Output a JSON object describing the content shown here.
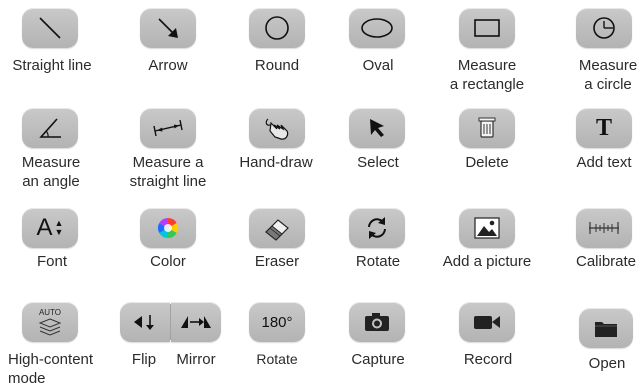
{
  "buttons": {
    "straight_line": "Straight line",
    "arrow": "Arrow",
    "round": "Round",
    "oval": "Oval",
    "measure_rectangle": "Measure\na rectangle",
    "measure_circle": "Measure\na circle",
    "measure_angle": "Measure\nan angle",
    "measure_straight_line": "Measure a\nstraight line",
    "hand_draw": "Hand-draw",
    "select": "Select",
    "delete": "Delete",
    "add_text": "Add text",
    "font": "Font",
    "color": "Color",
    "eraser": "Eraser",
    "rotate": "Rotate",
    "add_picture": "Add a picture",
    "calibrate": "Calibrate",
    "high_content_mode": "High-content\nmode",
    "flip": "Flip",
    "mirror": "Mirror",
    "rotate_180": "Rotate",
    "capture": "Capture",
    "record": "Record",
    "open": "Open"
  },
  "icon_text": {
    "add_text_glyph": "T",
    "font_glyph": "A",
    "auto": "AUTO",
    "rotate_180": "180°"
  },
  "icons": {
    "straight_line": "line-icon",
    "arrow": "arrow-icon",
    "round": "circle-icon",
    "oval": "oval-icon",
    "measure_rectangle": "rectangle-icon",
    "measure_circle": "circle-measure-icon",
    "measure_angle": "angle-icon",
    "measure_straight_line": "ruler-line-icon",
    "hand_draw": "hand-icon",
    "select": "cursor-icon",
    "delete": "trash-icon",
    "add_text": "text-icon",
    "font": "font-size-icon",
    "color": "color-wheel-icon",
    "eraser": "eraser-icon",
    "rotate": "rotate-icon",
    "add_picture": "image-icon",
    "calibrate": "calibrate-icon",
    "high_content_mode": "layers-icon",
    "flip": "flip-icon",
    "mirror": "mirror-icon",
    "rotate_180": "rotate-180-icon",
    "capture": "camera-icon",
    "record": "video-icon",
    "open": "folder-icon"
  }
}
